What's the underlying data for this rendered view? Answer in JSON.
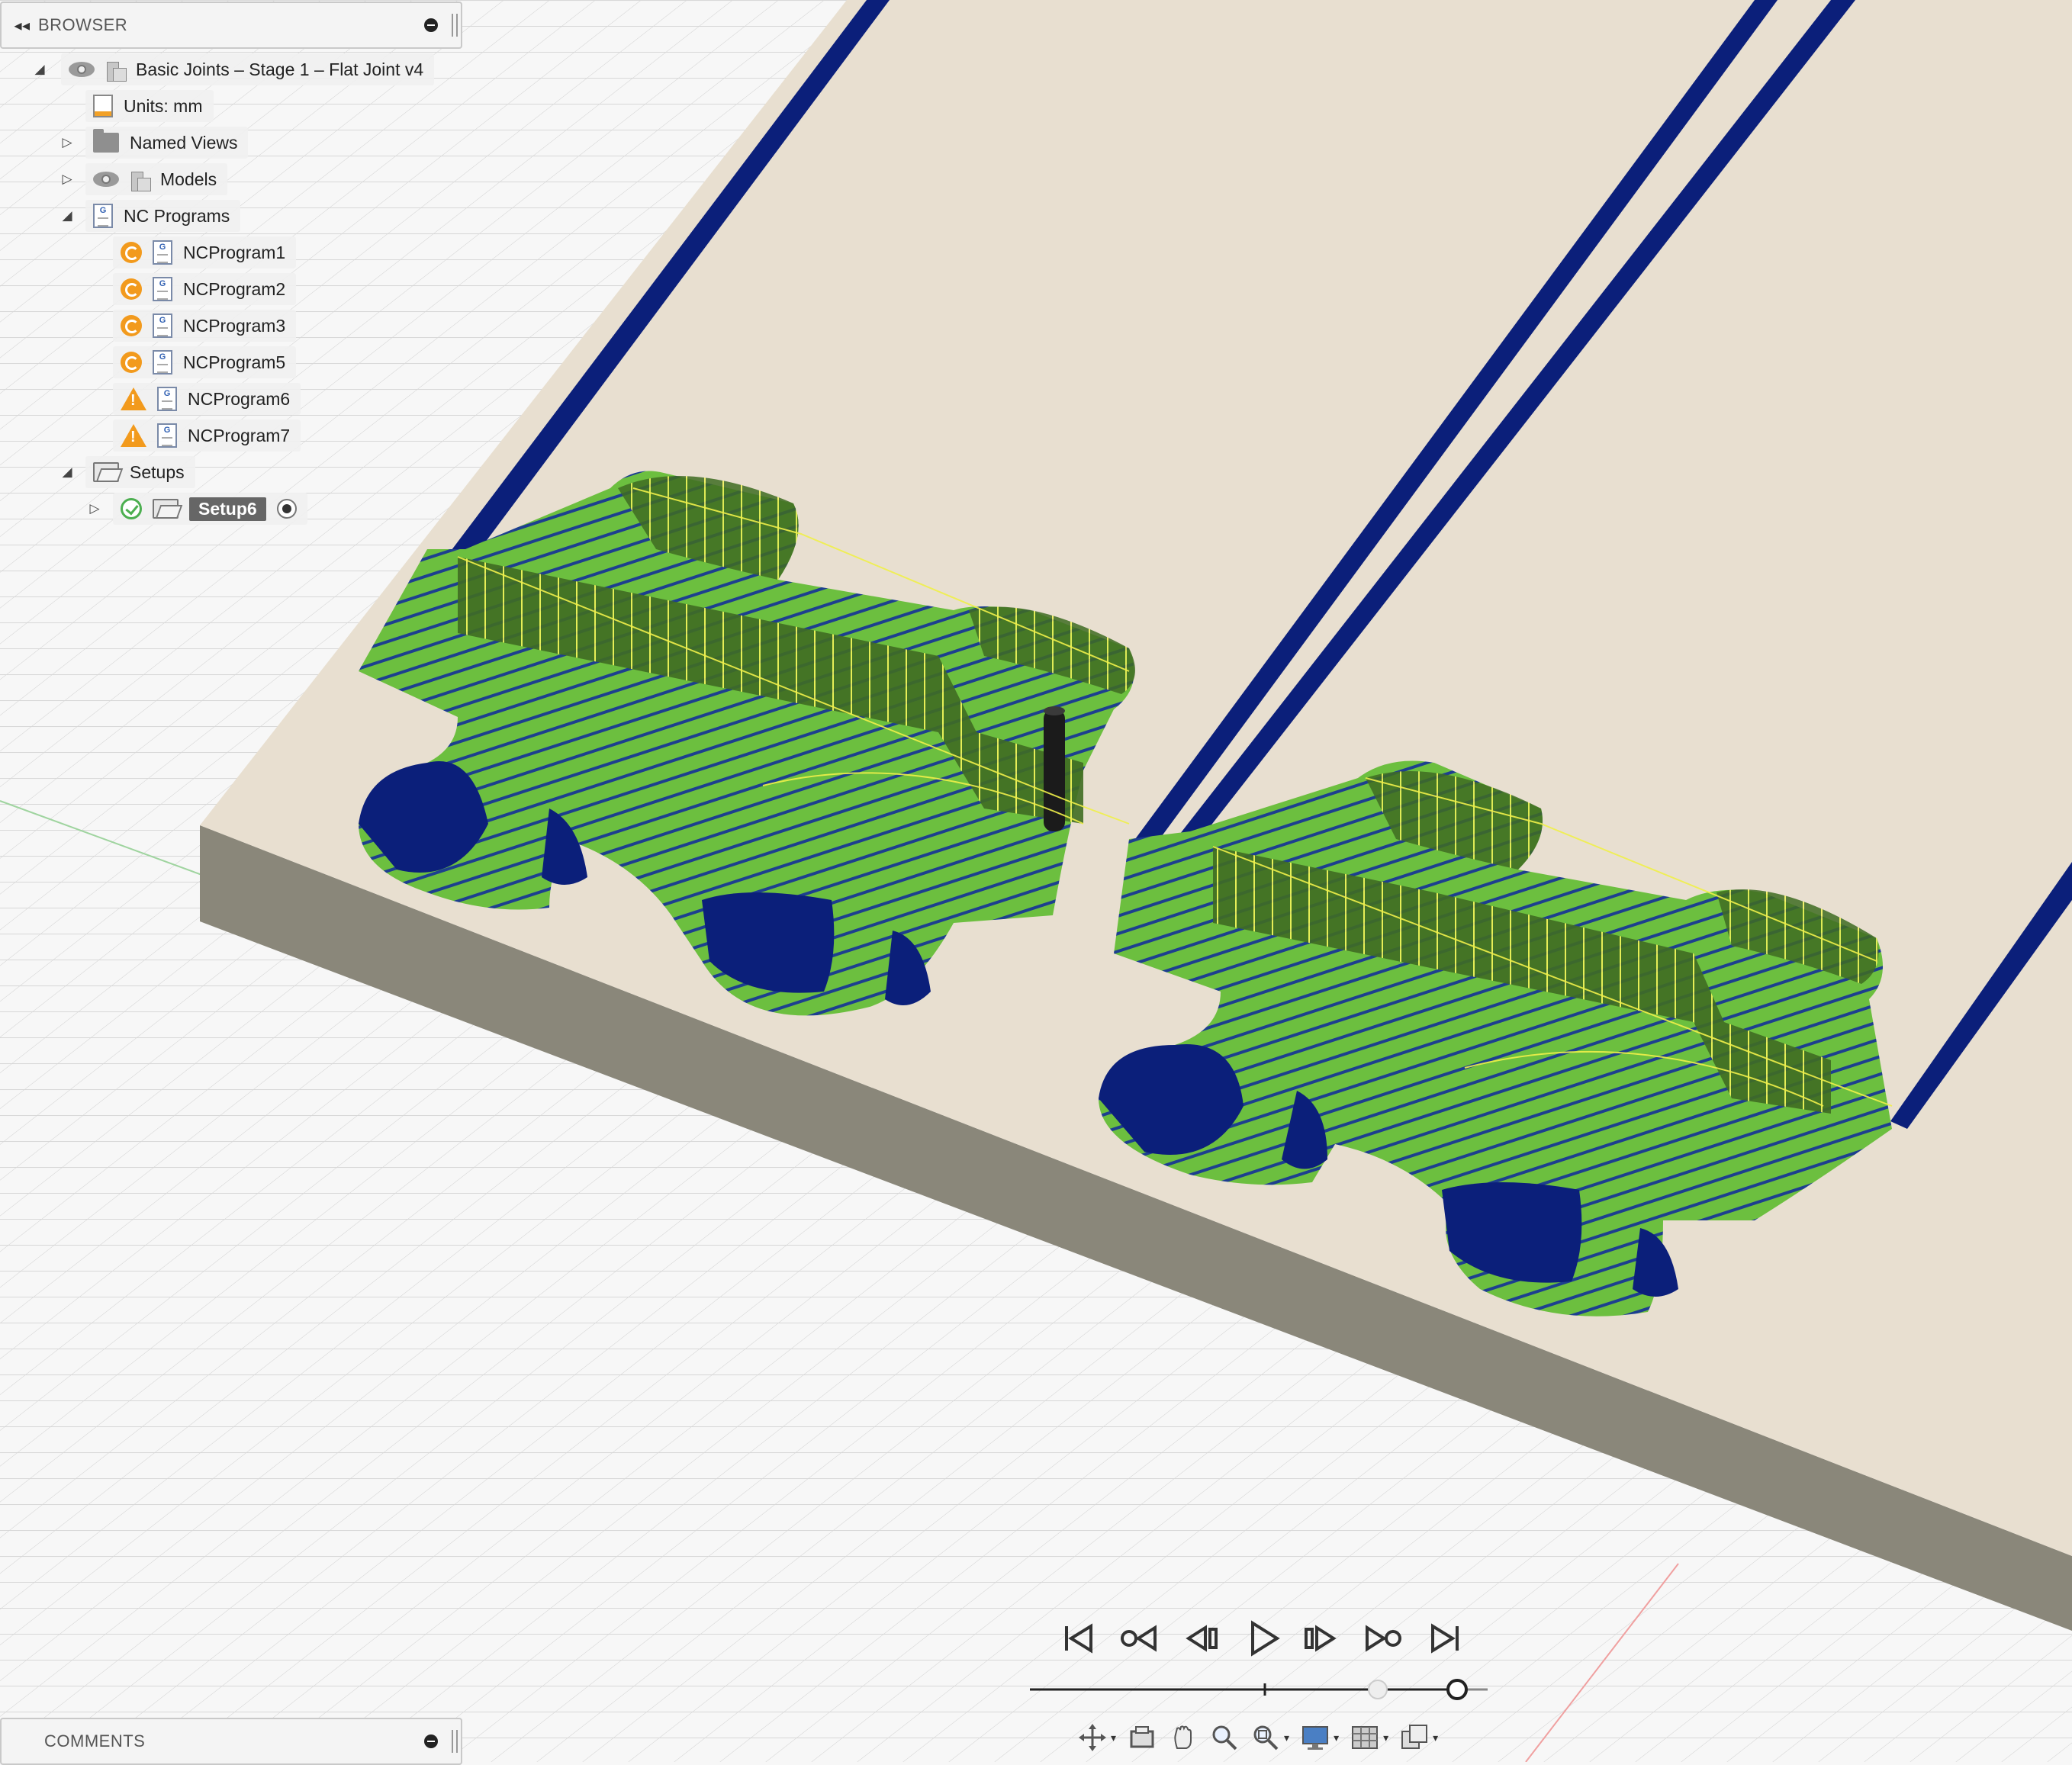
{
  "browser": {
    "collapse_glyph": "◂◂",
    "title": "BROWSER",
    "root": {
      "label": "Basic Joints – Stage 1 – Flat Joint v4",
      "expanded": true
    },
    "items": [
      {
        "label": "Units: mm"
      },
      {
        "label": "Named Views",
        "expanded": false
      },
      {
        "label": "Models",
        "expanded": false
      },
      {
        "label": "NC Programs",
        "expanded": true,
        "children": [
          {
            "label": "NCProgram1",
            "status": "generated"
          },
          {
            "label": "NCProgram2",
            "status": "generated"
          },
          {
            "label": "NCProgram3",
            "status": "generated"
          },
          {
            "label": "NCProgram5",
            "status": "generated"
          },
          {
            "label": "NCProgram6",
            "status": "warning"
          },
          {
            "label": "NCProgram7",
            "status": "warning"
          }
        ]
      },
      {
        "label": "Setups",
        "expanded": true,
        "children": [
          {
            "label": "Setup6",
            "status": "ok",
            "active": true
          }
        ]
      }
    ]
  },
  "comments": {
    "title": "COMMENTS"
  },
  "icons": {
    "visibility": "eye-icon",
    "component": "component-icon",
    "document": "document-settings-icon",
    "folder": "folder-icon",
    "folder_open": "folder-open-icon",
    "nc_file": "g-code-file-icon",
    "generated": "generated-status-icon",
    "warning": "warning-icon",
    "ok": "check-circle-icon",
    "active_setup": "active-radio-icon"
  },
  "playback": {
    "buttons": [
      "skip-to-start-icon",
      "previous-operation-icon",
      "step-back-icon",
      "play-icon",
      "step-forward-icon",
      "next-operation-icon",
      "skip-to-end-icon"
    ],
    "timeline_progress": 1.0
  },
  "navbar": {
    "tools": [
      "orbit-icon",
      "look-at-icon",
      "pan-icon",
      "zoom-icon",
      "fit-icon",
      "display-settings-icon",
      "grid-icon",
      "viewports-icon"
    ]
  },
  "colors": {
    "stock_top": "#e8dfd0",
    "stock_side": "#8a877a",
    "toolpath_green": "#6bbd3c",
    "wall_green": "#3e6b1f",
    "deep_blue": "#0b1f7a",
    "toolpath_yellow": "#f0f04a",
    "grid": "#d9d9d9"
  }
}
